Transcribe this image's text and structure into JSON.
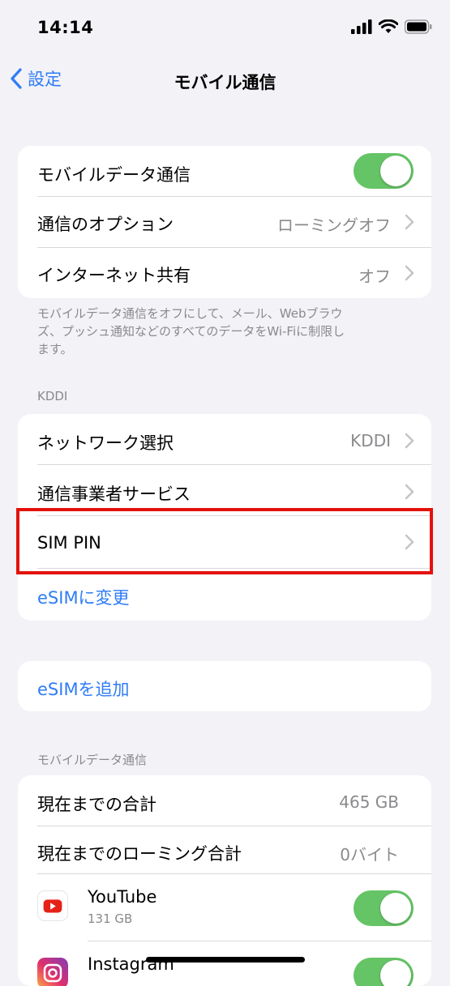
{
  "status": {
    "time": "14:14"
  },
  "nav": {
    "back_label": "設定",
    "title": "モバイル通信"
  },
  "group1": {
    "mobile_data_label": "モバイルデータ通信",
    "mobile_data_on": true,
    "options_label": "通信のオプション",
    "options_value": "ローミングオフ",
    "hotspot_label": "インターネット共有",
    "hotspot_value": "オフ"
  },
  "footnote": [
    "モバイルデータ通信をオフにして、メール、Webブラウ",
    "ズ、プッシュ通知などのすべてのデータをWi-Fiに制限し",
    "ます。"
  ],
  "carrier": {
    "header": "KDDI",
    "network_label": "ネットワーク選択",
    "network_value": "KDDI",
    "services_label": "通信事業者サービス",
    "sim_pin_label": "SIM PIN",
    "change_esim_label": "eSIMに変更"
  },
  "add_esim_label": "eSIMを追加",
  "usage": {
    "header": "モバイルデータ通信",
    "total_label": "現在までの合計",
    "total_value": "465 GB",
    "roaming_label": "現在までのローミング合計",
    "roaming_value": "0バイト",
    "apps": [
      {
        "name": "YouTube",
        "size": "131 GB",
        "enabled": true
      },
      {
        "name": "Instagram",
        "enabled": true
      }
    ]
  },
  "colors": {
    "accent": "#2f7cf6",
    "toggle_on": "#65c466",
    "highlight": "#e3120b"
  }
}
